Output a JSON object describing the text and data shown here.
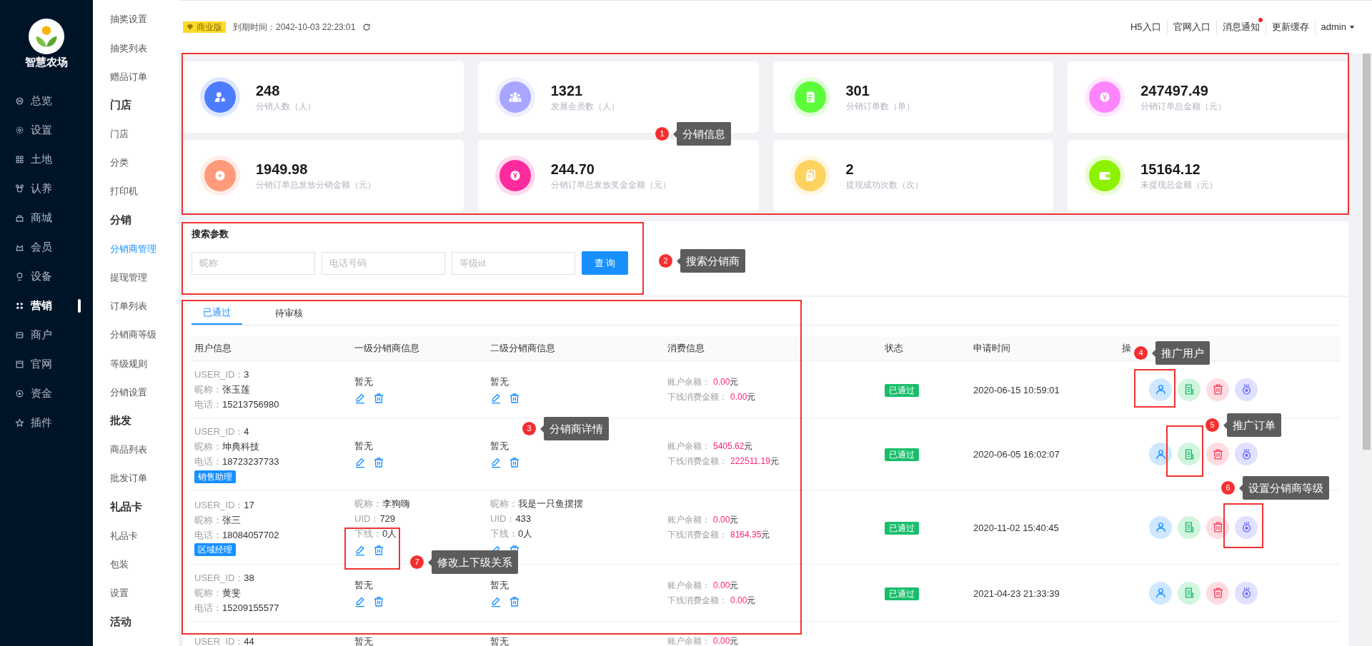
{
  "sidebar": {
    "logo_text": "智慧农场",
    "items": [
      {
        "label": "总览",
        "selected": false
      },
      {
        "label": "设置",
        "selected": false
      },
      {
        "label": "土地",
        "selected": false
      },
      {
        "label": "认养",
        "selected": false
      },
      {
        "label": "商城",
        "selected": false
      },
      {
        "label": "会员",
        "selected": false
      },
      {
        "label": "设备",
        "selected": false
      },
      {
        "label": "营销",
        "selected": true
      },
      {
        "label": "商户",
        "selected": false
      },
      {
        "label": "官网",
        "selected": false
      },
      {
        "label": "资金",
        "selected": false
      },
      {
        "label": "插件",
        "selected": false
      }
    ]
  },
  "submenu": {
    "items": [
      {
        "kind": "link",
        "label": "抽奖设置",
        "selected": false
      },
      {
        "kind": "link",
        "label": "抽奖列表",
        "selected": false
      },
      {
        "kind": "link",
        "label": "赠品订单",
        "selected": false
      },
      {
        "kind": "header",
        "label": "门店"
      },
      {
        "kind": "link",
        "label": "门店",
        "selected": false
      },
      {
        "kind": "link",
        "label": "分类",
        "selected": false
      },
      {
        "kind": "link",
        "label": "打印机",
        "selected": false
      },
      {
        "kind": "header",
        "label": "分销"
      },
      {
        "kind": "link",
        "label": "分销商管理",
        "selected": true
      },
      {
        "kind": "link",
        "label": "提现管理",
        "selected": false
      },
      {
        "kind": "link",
        "label": "订单列表",
        "selected": false
      },
      {
        "kind": "link",
        "label": "分销商等级",
        "selected": false
      },
      {
        "kind": "link",
        "label": "等级规则",
        "selected": false
      },
      {
        "kind": "link",
        "label": "分销设置",
        "selected": false
      },
      {
        "kind": "header",
        "label": "批发"
      },
      {
        "kind": "link",
        "label": "商品列表",
        "selected": false
      },
      {
        "kind": "link",
        "label": "批发订单",
        "selected": false
      },
      {
        "kind": "header",
        "label": "礼品卡"
      },
      {
        "kind": "link",
        "label": "礼品卡",
        "selected": false
      },
      {
        "kind": "link",
        "label": "包装",
        "selected": false
      },
      {
        "kind": "link",
        "label": "设置",
        "selected": false
      },
      {
        "kind": "header",
        "label": "活动"
      }
    ]
  },
  "header": {
    "edition": "商业版",
    "expiry": "到期时间：2042-10-03 22:23:01",
    "links": [
      {
        "label": "H5入口",
        "dot": false
      },
      {
        "label": "官网入口",
        "dot": false
      },
      {
        "label": "消息通知",
        "dot": true
      },
      {
        "label": "更新缓存",
        "dot": false
      }
    ],
    "user": "admin"
  },
  "stats": [
    {
      "value": "248",
      "label": "分销人数（人）",
      "color": "#4e7cff"
    },
    {
      "value": "1321",
      "label": "发展会员数（人）",
      "color": "#a8a6ff"
    },
    {
      "value": "301",
      "label": "分销订单数（单）",
      "color": "#5cfc3a"
    },
    {
      "value": "247497.49",
      "label": "分销订单总金额（元）",
      "color": "#ff85ff"
    },
    {
      "value": "1949.98",
      "label": "分销订单总发放分销金额（元）",
      "color": "#ff9a7b"
    },
    {
      "value": "244.70",
      "label": "分销订单总发放奖金金额（元）",
      "color": "#ff2a9d"
    },
    {
      "value": "2",
      "label": "提现成功次数（次）",
      "color": "#fdd35f"
    },
    {
      "value": "15164.12",
      "label": "未提现总金额（元）",
      "color": "#8cf200"
    }
  ],
  "search": {
    "title": "搜索参数",
    "fields": [
      {
        "placeholder": "昵称"
      },
      {
        "placeholder": "电话号码"
      },
      {
        "placeholder": "等级id"
      }
    ],
    "button": "查 询"
  },
  "tabs": [
    {
      "label": "已通过",
      "selected": true
    },
    {
      "label": "待审核",
      "selected": false
    }
  ],
  "table": {
    "columns": [
      "用户信息",
      "一级分销商信息",
      "二级分销商信息",
      "消费信息",
      "状态",
      "申请时间",
      "操"
    ],
    "rows": [
      {
        "user": [
          {
            "label": "USER_ID：",
            "value": "3"
          },
          {
            "label": "昵称：",
            "value": "张玉莲"
          },
          {
            "label": "电话：",
            "value": "15213756980"
          }
        ],
        "level1": {
          "text": "暂无"
        },
        "level2": {
          "text": "暂无"
        },
        "consumption": [
          {
            "label": "账户余额：",
            "value": "0.00",
            "unit": "元"
          },
          {
            "label": "下线消费金额：",
            "value": "0.00",
            "unit": "元"
          }
        ],
        "status": "已通过",
        "time": "2020-06-15 10:59:01",
        "actions": true
      },
      {
        "user": [
          {
            "label": "USER_ID：",
            "value": "4"
          },
          {
            "label": "昵称：",
            "value": "坤典科技"
          },
          {
            "label": "电话：",
            "value": "18723237733"
          }
        ],
        "tag": "销售助理",
        "level1": {
          "text": "暂无"
        },
        "level2": {
          "text": "暂无"
        },
        "consumption": [
          {
            "label": "账户余额：",
            "value": "5405.62",
            "unit": "元"
          },
          {
            "label": "下线消费金额：",
            "value": "222511.19",
            "unit": "元"
          }
        ],
        "status": "已通过",
        "time": "2020-06-05 16:02:07",
        "actions": true
      },
      {
        "user": [
          {
            "label": "USER_ID：",
            "value": "17"
          },
          {
            "label": "昵称：",
            "value": "张三"
          },
          {
            "label": "电话：",
            "value": "18084057702"
          }
        ],
        "tag": "区域经理",
        "level1": {
          "lines": [
            {
              "label": "昵称：",
              "value": "李狗嗨"
            },
            {
              "label": "UID：",
              "value": "729"
            },
            {
              "label": "下线：",
              "value": "0人"
            }
          ]
        },
        "level2": {
          "lines": [
            {
              "label": "昵称：",
              "value": "我是一只鱼摆摆"
            },
            {
              "label": "UID：",
              "value": "433"
            },
            {
              "label": "下线：",
              "value": "0人"
            }
          ]
        },
        "consumption": [
          {
            "label": "账户余额：",
            "value": "0.00",
            "unit": "元"
          },
          {
            "label": "下线消费金额：",
            "value": "8164.35",
            "unit": "元"
          }
        ],
        "status": "已通过",
        "time": "2020-11-02 15:40:45",
        "actions": true
      },
      {
        "user": [
          {
            "label": "USER_ID：",
            "value": "38"
          },
          {
            "label": "昵称：",
            "value": "黄斐"
          },
          {
            "label": "电话：",
            "value": "15209155577"
          }
        ],
        "level1": {
          "text": "暂无"
        },
        "level2": {
          "text": "暂无"
        },
        "consumption": [
          {
            "label": "账户余额：",
            "value": "0.00",
            "unit": "元"
          },
          {
            "label": "下线消费金额：",
            "value": "0.00",
            "unit": "元"
          }
        ],
        "status": "已通过",
        "time": "2021-04-23 21:33:39",
        "actions": true
      },
      {
        "user": [
          {
            "label": "USER_ID：",
            "value": "44"
          }
        ],
        "level1": {
          "text": "暂无"
        },
        "level2": {
          "text": "暂无"
        },
        "consumption": [
          {
            "label": "账户余额：",
            "value": "0.00",
            "unit": "元"
          }
        ],
        "actions": false
      }
    ]
  },
  "annotations": [
    {
      "number": "1",
      "label": "分销信息"
    },
    {
      "number": "2",
      "label": "搜索分销商"
    },
    {
      "number": "3",
      "label": "分销商详情"
    },
    {
      "number": "4",
      "label": "推广用户"
    },
    {
      "number": "5",
      "label": "推广订单"
    },
    {
      "number": "6",
      "label": "设置分销商等级"
    },
    {
      "number": "7",
      "label": "修改上下级关系"
    }
  ]
}
